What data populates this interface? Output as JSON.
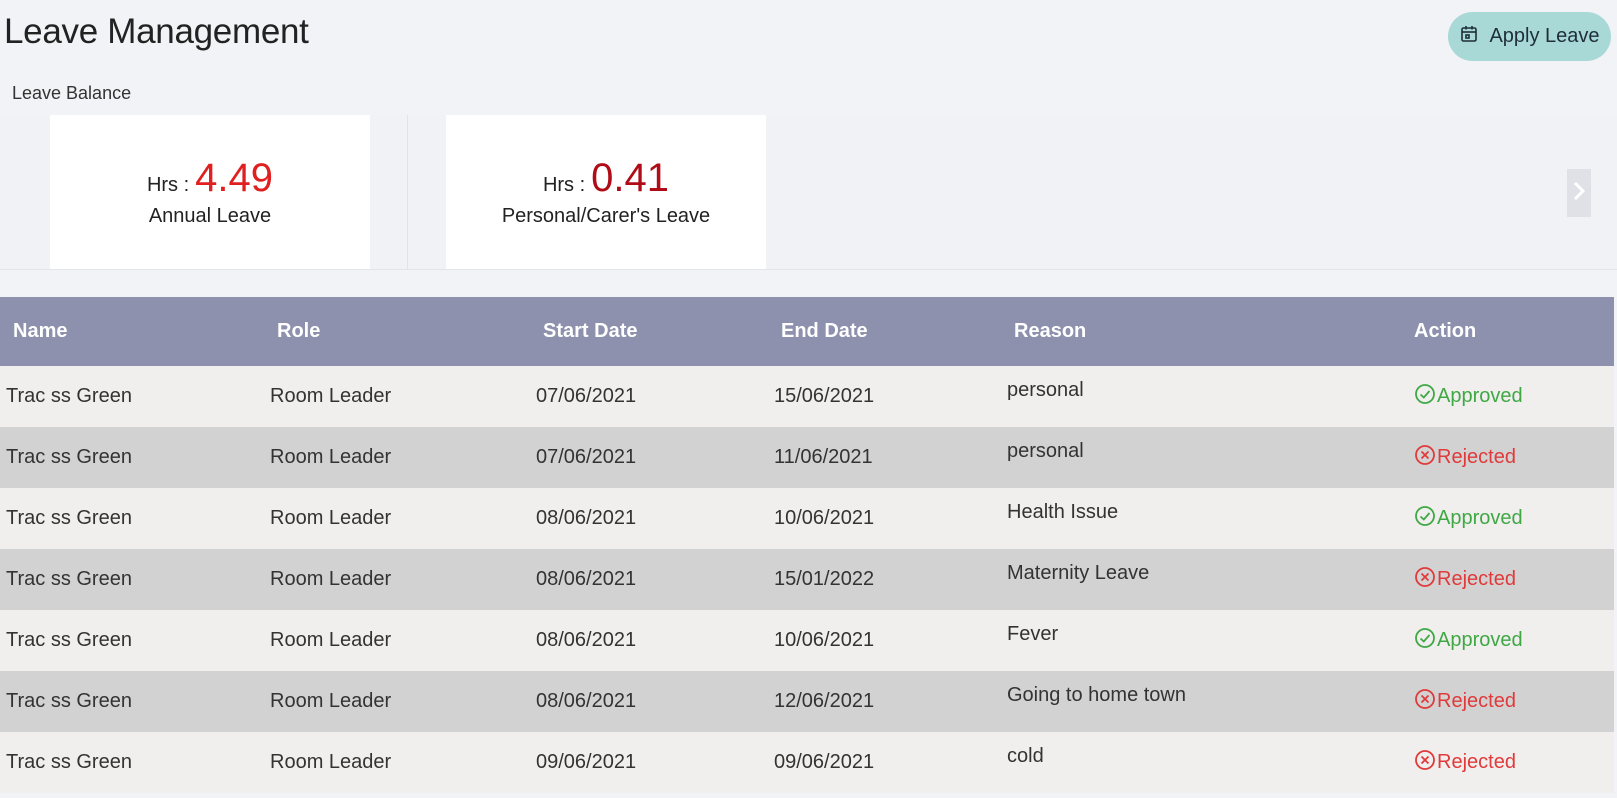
{
  "header": {
    "title": "Leave Management",
    "apply_button": "Apply Leave",
    "apply_icon": "calendar-icon"
  },
  "balance": {
    "label": "Leave Balance",
    "prefix": "Hrs :",
    "cards": [
      {
        "value": "4.49",
        "type": "Annual Leave",
        "color": "#e02020"
      },
      {
        "value": "0.41",
        "type": "Personal/Carer's Leave",
        "color": "#b00c18"
      }
    ],
    "next_icon": "chevron-right-icon"
  },
  "table": {
    "header_color": "#8d91ad",
    "columns": {
      "name": "Name",
      "role": "Role",
      "start": "Start Date",
      "end": "End Date",
      "reason": "Reason",
      "action": "Action"
    },
    "status_colors": {
      "approved": "#3fa844",
      "rejected": "#e03a3a"
    },
    "rows": [
      {
        "name": "Trac ss Green",
        "role": "Room Leader",
        "start": "07/06/2021",
        "end": "15/06/2021",
        "reason": "personal",
        "status": "Approved"
      },
      {
        "name": "Trac ss Green",
        "role": "Room Leader",
        "start": "07/06/2021",
        "end": "11/06/2021",
        "reason": "personal",
        "status": "Rejected"
      },
      {
        "name": "Trac ss Green",
        "role": "Room Leader",
        "start": "08/06/2021",
        "end": "10/06/2021",
        "reason": "Health Issue",
        "status": "Approved"
      },
      {
        "name": "Trac ss Green",
        "role": "Room Leader",
        "start": "08/06/2021",
        "end": "15/01/2022",
        "reason": "Maternity Leave",
        "status": "Rejected"
      },
      {
        "name": "Trac ss Green",
        "role": "Room Leader",
        "start": "08/06/2021",
        "end": "10/06/2021",
        "reason": "Fever",
        "status": "Approved"
      },
      {
        "name": "Trac ss Green",
        "role": "Room Leader",
        "start": "08/06/2021",
        "end": "12/06/2021",
        "reason": "Going to home town",
        "status": "Rejected"
      },
      {
        "name": "Trac ss Green",
        "role": "Room Leader",
        "start": "09/06/2021",
        "end": "09/06/2021",
        "reason": "cold",
        "status": "Rejected"
      }
    ]
  }
}
